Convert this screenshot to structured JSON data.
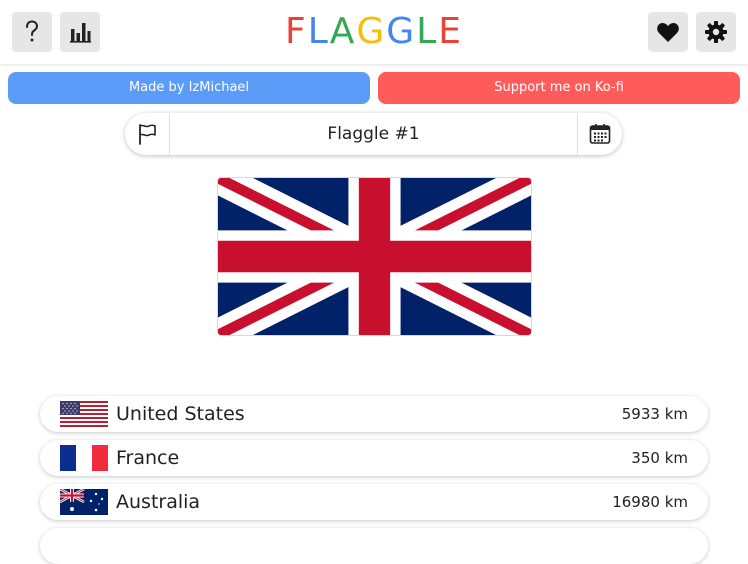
{
  "header": {
    "help_icon": "question-mark-icon",
    "stats_icon": "bar-chart-icon",
    "favorite_icon": "heart-icon",
    "settings_icon": "gear-icon",
    "logo_letters": [
      {
        "char": "F",
        "color": "#ea4335"
      },
      {
        "char": "L",
        "color": "#4285f4"
      },
      {
        "char": "A",
        "color": "#34a853"
      },
      {
        "char": "G",
        "color": "#fbbc05"
      },
      {
        "char": "G",
        "color": "#4285f4"
      },
      {
        "char": "L",
        "color": "#34a853"
      },
      {
        "char": "E",
        "color": "#ea4335"
      }
    ]
  },
  "links": {
    "made_by": {
      "label": "Made by IzMichael",
      "color": "#5b9cf8"
    },
    "support": {
      "label": "Support me on Ko-fi",
      "color": "#ff5b5b"
    }
  },
  "game": {
    "title": "Flaggle #1",
    "mode_icon": "flag-icon",
    "calendar_icon": "calendar-icon",
    "target_flag": "united-kingdom-flag"
  },
  "guesses": [
    {
      "country": "United States",
      "distance": "5933 km",
      "flag": "united-states-flag"
    },
    {
      "country": "France",
      "distance": "350 km",
      "flag": "france-flag"
    },
    {
      "country": "Australia",
      "distance": "16980 km",
      "flag": "australia-flag"
    }
  ]
}
